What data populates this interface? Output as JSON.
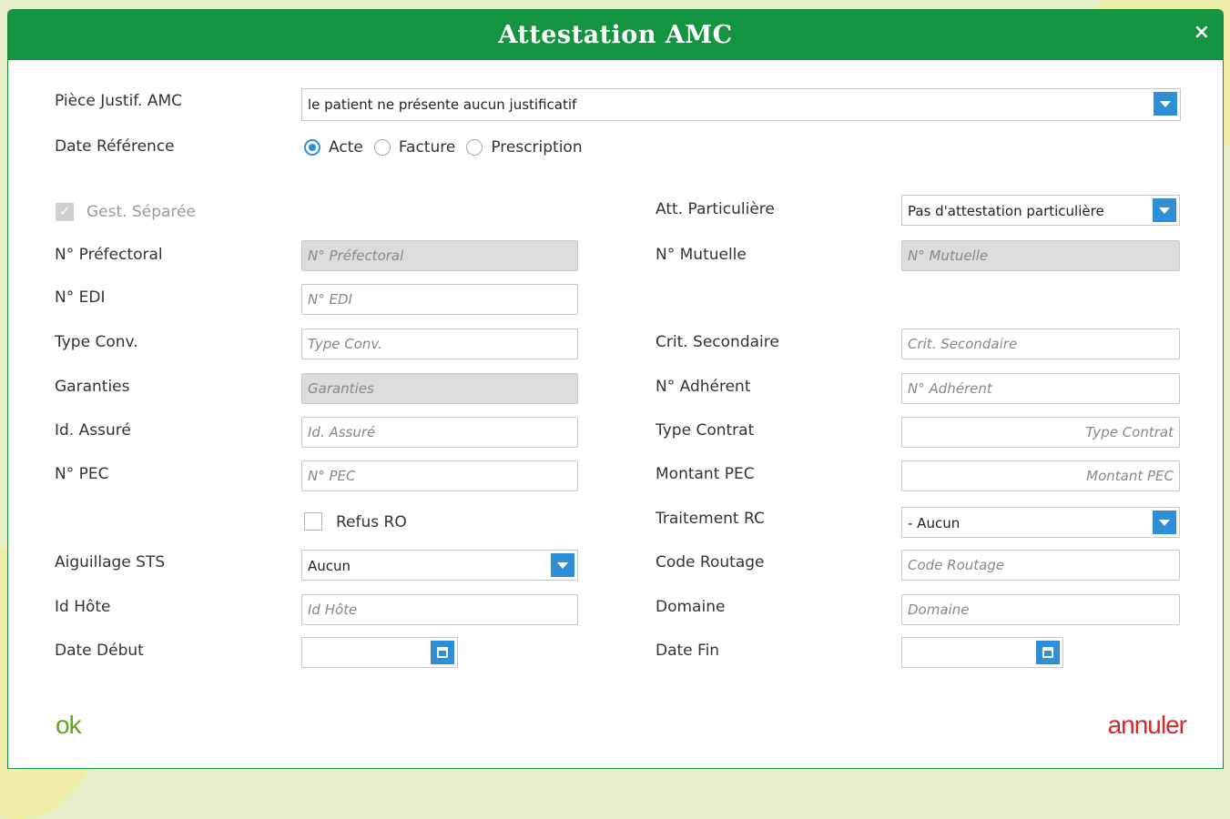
{
  "dialog": {
    "title": "Attestation AMC",
    "close_symbol": "×"
  },
  "piece": {
    "label": "Pièce Justif. AMC",
    "value": "le patient ne présente aucun justificatif"
  },
  "date_ref": {
    "label": "Date Référence",
    "options": [
      "Acte",
      "Facture",
      "Prescription"
    ],
    "selected": "Acte"
  },
  "gest": {
    "label": "Gest. Séparée",
    "checked": true,
    "disabled": true
  },
  "att": {
    "label": "Att. Particulière",
    "value": "Pas d'attestation particulière"
  },
  "prefectoral": {
    "label": "N° Préfectoral",
    "placeholder": "N° Préfectoral"
  },
  "mutuelle": {
    "label": "N° Mutuelle",
    "placeholder": "N° Mutuelle"
  },
  "edi": {
    "label": "N° EDI",
    "placeholder": "N° EDI"
  },
  "type_conv": {
    "label": "Type Conv.",
    "placeholder": "Type Conv."
  },
  "crit": {
    "label": "Crit. Secondaire",
    "placeholder": "Crit. Secondaire"
  },
  "garanties": {
    "label": "Garanties",
    "placeholder": "Garanties"
  },
  "adherent": {
    "label": "N° Adhérent",
    "placeholder": "N° Adhérent"
  },
  "id_assure": {
    "label": "Id. Assuré",
    "placeholder": "Id. Assuré"
  },
  "type_contrat": {
    "label": "Type Contrat",
    "placeholder": "Type Contrat"
  },
  "pec": {
    "label": "N° PEC",
    "placeholder": "N° PEC"
  },
  "montant_pec": {
    "label": "Montant PEC",
    "placeholder": "Montant PEC"
  },
  "refus_ro": {
    "label": "Refus RO",
    "checked": false
  },
  "traitement_rc": {
    "label": "Traitement RC",
    "value": "- Aucun"
  },
  "aiguillage": {
    "label": "Aiguillage STS",
    "value": "Aucun"
  },
  "code_routage": {
    "label": "Code Routage",
    "placeholder": "Code Routage"
  },
  "id_hote": {
    "label": "Id Hôte",
    "placeholder": "Id Hôte"
  },
  "domaine": {
    "label": "Domaine",
    "placeholder": "Domaine"
  },
  "date_debut": {
    "label": "Date Début",
    "value": ""
  },
  "date_fin": {
    "label": "Date Fin",
    "value": ""
  },
  "actions": {
    "ok": "ok",
    "cancel": "annuler"
  },
  "colors": {
    "header": "#14943e",
    "accent_blue": "#2f8fd6",
    "ok": "#5aa822",
    "cancel": "#d42a2a"
  },
  "icons": {
    "dropdown": "chevron-down-icon",
    "calendar": "calendar-icon",
    "close": "close-icon"
  }
}
